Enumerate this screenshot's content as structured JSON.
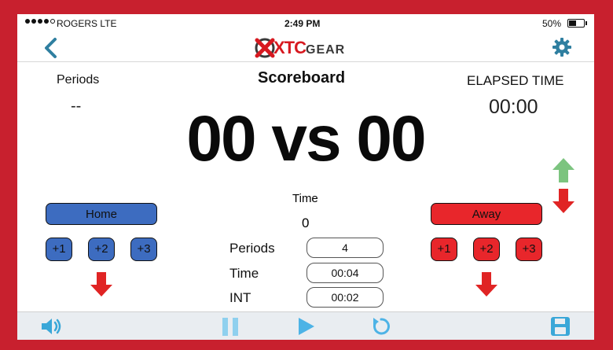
{
  "status_bar": {
    "carrier": "ROGERS  LTE",
    "time": "2:49 PM",
    "battery_pct": "50%",
    "battery_level": 0.5
  },
  "header": {
    "logo_main": "XTC",
    "logo_sub": "GEAR"
  },
  "scoreboard": {
    "title": "Scoreboard",
    "periods_label": "Periods",
    "periods_value": "--",
    "elapsed_label": "ELAPSED TIME",
    "elapsed_value": "00:00",
    "score_text": "00 vs 00"
  },
  "home": {
    "label": "Home",
    "increments": [
      "+1",
      "+2",
      "+3"
    ]
  },
  "away": {
    "label": "Away",
    "increments": [
      "+1",
      "+2",
      "+3"
    ]
  },
  "timer": {
    "label": "Time",
    "value": "0"
  },
  "settings": {
    "periods_label": "Periods",
    "periods_value": "4",
    "time_label": "Time",
    "time_value": "00:04",
    "int_label": "INT",
    "int_value": "00:02"
  },
  "colors": {
    "frame": "#c8202e",
    "home": "#3d6cc0",
    "away": "#e8262b",
    "accent": "#2f7fa0",
    "green": "#7cc47f"
  },
  "icons": {
    "back": "chevron-left-icon",
    "settings": "gear-icon",
    "volume": "speaker-icon",
    "pause": "pause-icon",
    "play": "play-icon",
    "reset": "refresh-icon",
    "save": "floppy-disk-icon"
  }
}
